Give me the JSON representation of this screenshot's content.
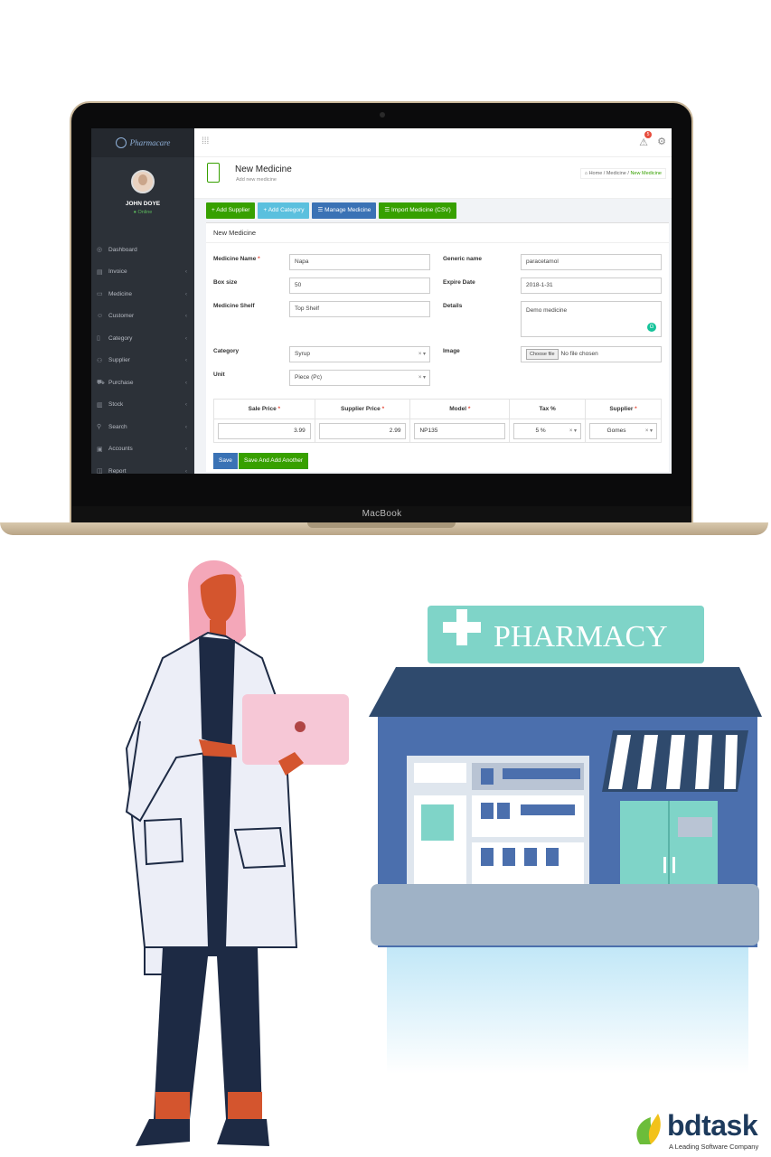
{
  "app": {
    "brand": "Pharmacare",
    "user": {
      "name": "JOHN DOYE",
      "status": "Online"
    },
    "alert_count": "5",
    "sidebar": [
      {
        "label": "Dashboard",
        "icon": "dashboard-icon",
        "glyph": "◎",
        "has_children": false
      },
      {
        "label": "Invoice",
        "icon": "invoice-icon",
        "glyph": "▤",
        "has_children": true
      },
      {
        "label": "Medicine",
        "icon": "medicine-icon",
        "glyph": "▭",
        "has_children": true
      },
      {
        "label": "Customer",
        "icon": "customer-icon",
        "glyph": "☺",
        "has_children": true
      },
      {
        "label": "Category",
        "icon": "category-icon",
        "glyph": "▯",
        "has_children": true
      },
      {
        "label": "Supplier",
        "icon": "supplier-icon",
        "glyph": "⚇",
        "has_children": true
      },
      {
        "label": "Purchase",
        "icon": "purchase-icon",
        "glyph": "⛟",
        "has_children": true
      },
      {
        "label": "Stock",
        "icon": "stock-icon",
        "glyph": "▥",
        "has_children": true
      },
      {
        "label": "Search",
        "icon": "search-icon",
        "glyph": "⚲",
        "has_children": true
      },
      {
        "label": "Accounts",
        "icon": "accounts-icon",
        "glyph": "▣",
        "has_children": true
      },
      {
        "label": "Report",
        "icon": "report-icon",
        "glyph": "◫",
        "has_children": true
      }
    ],
    "page": {
      "title": "New Medicine",
      "subtitle": "Add new medicine",
      "breadcrumb": {
        "home": "Home",
        "sep": " / ",
        "section": "Medicine",
        "current": "New Medicine"
      }
    },
    "actions": [
      {
        "label": "+ Add Supplier",
        "color": "green"
      },
      {
        "label": "+ Add Category",
        "color": "cyan"
      },
      {
        "label": "☰ Manage Medicine",
        "color": "blue"
      },
      {
        "label": "☰ Import Medicine (CSV)",
        "color": "green"
      }
    ],
    "panel_title": "New Medicine",
    "form": {
      "medicine_name": {
        "label": "Medicine Name",
        "value": "Napa"
      },
      "generic_name": {
        "label": "Generic name",
        "value": "paracetamol"
      },
      "box_size": {
        "label": "Box size",
        "value": "50"
      },
      "expire_date": {
        "label": "Expire Date",
        "value": "2018-1-31"
      },
      "medicine_shelf": {
        "label": "Medicine Shelf",
        "value": "Top Shelf"
      },
      "details": {
        "label": "Details",
        "value": "Demo medicine"
      },
      "category": {
        "label": "Category",
        "value": "Syrup"
      },
      "image": {
        "label": "Image",
        "button": "Choose file",
        "status": "No file chosen"
      },
      "unit": {
        "label": "Unit",
        "value": "Piece (Pc)"
      }
    },
    "price_table": {
      "headers": [
        "Sale Price",
        "Supplier Price",
        "Model",
        "Tax %",
        "Supplier"
      ],
      "required_mark": "*",
      "row": {
        "sale_price": "3.99",
        "supplier_price": "2.99",
        "model": "NP135",
        "tax": "5 %",
        "supplier": "Gomes"
      }
    },
    "buttons": {
      "save": "Save",
      "save_add": "Save And Add Another"
    }
  },
  "device_label": "MacBook",
  "store_sign": "PHARMACY",
  "footer_logo": {
    "name": "bdtask",
    "tagline": "A Leading Software Company"
  },
  "colors": {
    "accent_green": "#37a000",
    "accent_blue": "#3a72b5",
    "accent_cyan": "#5bc0de",
    "sidebar_bg": "#2c3138",
    "store_sign_bg": "#7fd4c8",
    "store_roof": "#2f4a6d"
  }
}
